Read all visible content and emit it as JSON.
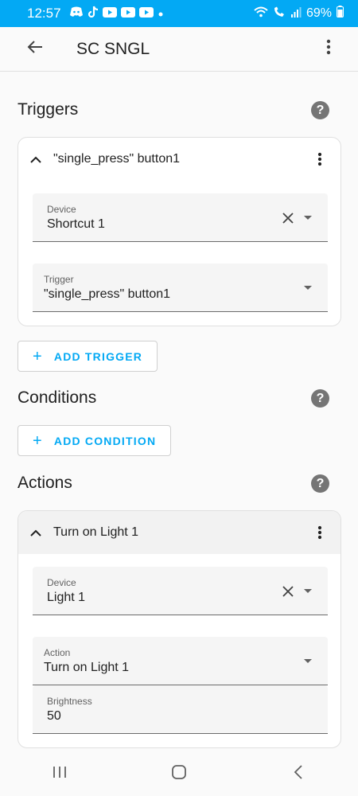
{
  "status_bar": {
    "time": "12:57",
    "battery": "69%"
  },
  "app_bar": {
    "title": "SC SNGL"
  },
  "triggers": {
    "title": "Triggers",
    "card": {
      "title": "\"single_press\" button1",
      "device_field": {
        "label": "Device",
        "value": "Shortcut 1"
      },
      "trigger_field": {
        "label": "Trigger",
        "value": "\"single_press\" button1"
      }
    },
    "add_button": "ADD TRIGGER"
  },
  "conditions": {
    "title": "Conditions",
    "add_button": "ADD CONDITION"
  },
  "actions": {
    "title": "Actions",
    "card": {
      "title": "Turn on Light 1",
      "device_field": {
        "label": "Device",
        "value": "Light 1"
      },
      "action_field": {
        "label": "Action",
        "value": "Turn on Light 1"
      },
      "brightness_field": {
        "label": "Brightness",
        "value": "50"
      }
    }
  },
  "colors": {
    "accent": "#03a9f4",
    "status_bar": "#03a9f4",
    "help_icon": "#757575"
  },
  "icons": [
    "back-arrow-icon",
    "overflow-menu-icon",
    "help-icon",
    "chevron-up-icon",
    "clear-icon",
    "dropdown-arrow-icon",
    "plus-icon",
    "recents-icon",
    "home-icon",
    "nav-back-icon"
  ]
}
